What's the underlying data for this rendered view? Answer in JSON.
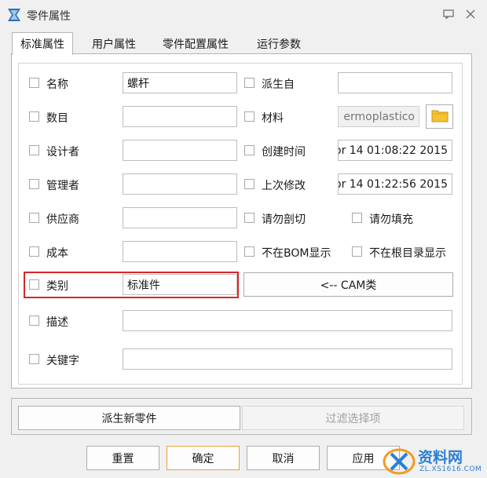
{
  "window": {
    "title": "零件属性"
  },
  "tabs": [
    "标准属性",
    "用户属性",
    "零件配置属性",
    "运行参数"
  ],
  "left_fields": [
    {
      "label": "名称",
      "value": "螺杆"
    },
    {
      "label": "数目",
      "value": ""
    },
    {
      "label": "设计者",
      "value": ""
    },
    {
      "label": "管理者",
      "value": ""
    },
    {
      "label": "供应商",
      "value": ""
    },
    {
      "label": "成本",
      "value": ""
    },
    {
      "label": "类别",
      "value": "标准件"
    },
    {
      "label": "描述",
      "value": ""
    },
    {
      "label": "关键字",
      "value": ""
    }
  ],
  "right_fields": [
    {
      "label": "派生自",
      "value": ""
    },
    {
      "label": "材料",
      "value": "ermoplastico"
    },
    {
      "label": "创建时间",
      "value": "or 14 01:08:22 2015"
    },
    {
      "label": "上次修改",
      "value": "or 14 01:22:56 2015"
    }
  ],
  "checks": {
    "no_cut": "请勿剖切",
    "no_fill": "请勿填充",
    "not_in_bom": "不在BOM显示",
    "not_in_root": "不在根目录显示"
  },
  "cam_button": "<-- CAM类",
  "actions": {
    "derive": "派生新零件",
    "filter": "过滤选择项"
  },
  "buttons": {
    "reset": "重置",
    "ok": "确定",
    "cancel": "取消",
    "apply": "应用"
  },
  "watermark": {
    "brand": "资料网",
    "url": "ZL.XS1616.COM"
  },
  "colors": {
    "highlight": "#d7262a",
    "default_button_border": "#e8a33a",
    "folder": "#f5c232"
  }
}
